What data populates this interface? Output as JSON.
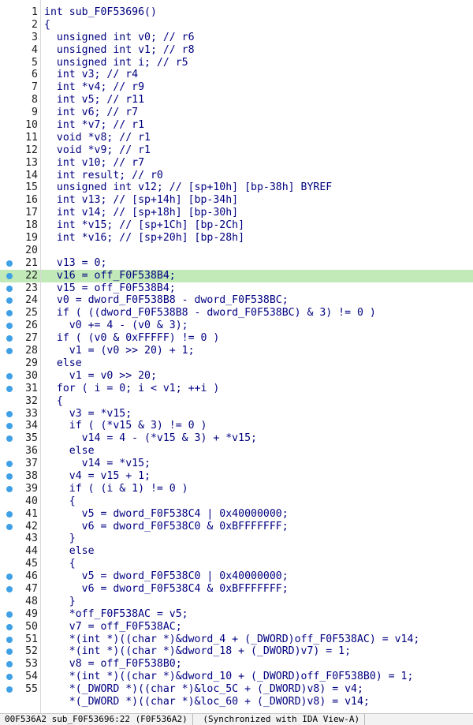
{
  "editor": {
    "lines": [
      {
        "n": "1",
        "t": "int sub_F0F53696()",
        "dot": false,
        "hl": false
      },
      {
        "n": "2",
        "t": "{",
        "dot": false,
        "hl": false
      },
      {
        "n": "3",
        "t": "  unsigned int v0; // r6",
        "dot": false,
        "hl": false
      },
      {
        "n": "4",
        "t": "  unsigned int v1; // r8",
        "dot": false,
        "hl": false
      },
      {
        "n": "5",
        "t": "  unsigned int i; // r5",
        "dot": false,
        "hl": false
      },
      {
        "n": "6",
        "t": "  int v3; // r4",
        "dot": false,
        "hl": false
      },
      {
        "n": "7",
        "t": "  int *v4; // r9",
        "dot": false,
        "hl": false
      },
      {
        "n": "8",
        "t": "  int v5; // r11",
        "dot": false,
        "hl": false
      },
      {
        "n": "9",
        "t": "  int v6; // r7",
        "dot": false,
        "hl": false
      },
      {
        "n": "10",
        "t": "  int *v7; // r1",
        "dot": false,
        "hl": false
      },
      {
        "n": "11",
        "t": "  void *v8; // r1",
        "dot": false,
        "hl": false
      },
      {
        "n": "12",
        "t": "  void *v9; // r1",
        "dot": false,
        "hl": false
      },
      {
        "n": "13",
        "t": "  int v10; // r7",
        "dot": false,
        "hl": false
      },
      {
        "n": "14",
        "t": "  int result; // r0",
        "dot": false,
        "hl": false
      },
      {
        "n": "15",
        "t": "  unsigned int v12; // [sp+10h] [bp-38h] BYREF",
        "dot": false,
        "hl": false
      },
      {
        "n": "16",
        "t": "  int v13; // [sp+14h] [bp-34h]",
        "dot": false,
        "hl": false
      },
      {
        "n": "17",
        "t": "  int v14; // [sp+18h] [bp-30h]",
        "dot": false,
        "hl": false
      },
      {
        "n": "18",
        "t": "  int *v15; // [sp+1Ch] [bp-2Ch]",
        "dot": false,
        "hl": false
      },
      {
        "n": "19",
        "t": "  int *v16; // [sp+20h] [bp-28h]",
        "dot": false,
        "hl": false
      },
      {
        "n": "20",
        "t": "",
        "dot": false,
        "hl": false
      },
      {
        "n": "21",
        "t": "  v13 = 0;",
        "dot": true,
        "hl": false
      },
      {
        "n": "22",
        "t": "  v16 = off_F0F538B4;",
        "dot": true,
        "hl": true
      },
      {
        "n": "23",
        "t": "  v15 = off_F0F538B4;",
        "dot": true,
        "hl": false
      },
      {
        "n": "24",
        "t": "  v0 = dword_F0F538B8 - dword_F0F538BC;",
        "dot": true,
        "hl": false
      },
      {
        "n": "25",
        "t": "  if ( ((dword_F0F538B8 - dword_F0F538BC) & 3) != 0 )",
        "dot": true,
        "hl": false
      },
      {
        "n": "26",
        "t": "    v0 += 4 - (v0 & 3);",
        "dot": true,
        "hl": false
      },
      {
        "n": "27",
        "t": "  if ( (v0 & 0xFFFFF) != 0 )",
        "dot": true,
        "hl": false
      },
      {
        "n": "28",
        "t": "    v1 = (v0 >> 20) + 1;",
        "dot": true,
        "hl": false
      },
      {
        "n": "29",
        "t": "  else",
        "dot": false,
        "hl": false
      },
      {
        "n": "30",
        "t": "    v1 = v0 >> 20;",
        "dot": true,
        "hl": false
      },
      {
        "n": "31",
        "t": "  for ( i = 0; i < v1; ++i )",
        "dot": true,
        "hl": false
      },
      {
        "n": "32",
        "t": "  {",
        "dot": false,
        "hl": false
      },
      {
        "n": "33",
        "t": "    v3 = *v15;",
        "dot": true,
        "hl": false
      },
      {
        "n": "34",
        "t": "    if ( (*v15 & 3) != 0 )",
        "dot": true,
        "hl": false
      },
      {
        "n": "35",
        "t": "      v14 = 4 - (*v15 & 3) + *v15;",
        "dot": true,
        "hl": false
      },
      {
        "n": "36",
        "t": "    else",
        "dot": false,
        "hl": false
      },
      {
        "n": "37",
        "t": "      v14 = *v15;",
        "dot": true,
        "hl": false
      },
      {
        "n": "38",
        "t": "    v4 = v15 + 1;",
        "dot": true,
        "hl": false
      },
      {
        "n": "39",
        "t": "    if ( (i & 1) != 0 )",
        "dot": true,
        "hl": false
      },
      {
        "n": "40",
        "t": "    {",
        "dot": false,
        "hl": false
      },
      {
        "n": "41",
        "t": "      v5 = dword_F0F538C4 | 0x40000000;",
        "dot": true,
        "hl": false
      },
      {
        "n": "42",
        "t": "      v6 = dword_F0F538C0 & 0xBFFFFFFF;",
        "dot": true,
        "hl": false
      },
      {
        "n": "43",
        "t": "    }",
        "dot": false,
        "hl": false
      },
      {
        "n": "44",
        "t": "    else",
        "dot": false,
        "hl": false
      },
      {
        "n": "45",
        "t": "    {",
        "dot": false,
        "hl": false
      },
      {
        "n": "46",
        "t": "      v5 = dword_F0F538C0 | 0x40000000;",
        "dot": true,
        "hl": false
      },
      {
        "n": "47",
        "t": "      v6 = dword_F0F538C4 & 0xBFFFFFFF;",
        "dot": true,
        "hl": false
      },
      {
        "n": "48",
        "t": "    }",
        "dot": false,
        "hl": false
      },
      {
        "n": "49",
        "t": "    *off_F0F538AC = v5;",
        "dot": true,
        "hl": false
      },
      {
        "n": "50",
        "t": "    v7 = off_F0F538AC;",
        "dot": true,
        "hl": false
      },
      {
        "n": "51",
        "t": "    *(int *)((char *)&dword_4 + (_DWORD)off_F0F538AC) = v14;",
        "dot": true,
        "hl": false
      },
      {
        "n": "52",
        "t": "    *(int *)((char *)&dword_18 + (_DWORD)v7) = 1;",
        "dot": true,
        "hl": false
      },
      {
        "n": "53",
        "t": "    v8 = off_F0F538B0;",
        "dot": true,
        "hl": false
      },
      {
        "n": "54",
        "t": "    *(int *)((char *)&dword_10 + (_DWORD)off_F0F538B0) = 1;",
        "dot": true,
        "hl": false
      },
      {
        "n": "55",
        "t": "    *(_DWORD *)((char *)&loc_5C + (_DWORD)v8) = v4;",
        "dot": true,
        "hl": false
      },
      {
        "n": "",
        "t": "    *(_DWORD *)((char *)&loc_60 + (_DWORD)v8) = v14;",
        "dot": false,
        "hl": false
      }
    ]
  },
  "statusbar": {
    "position": "00F536A2 sub_F0F53696:22 (F0F536A2)",
    "sync": "(Synchronized with IDA View-A)"
  }
}
